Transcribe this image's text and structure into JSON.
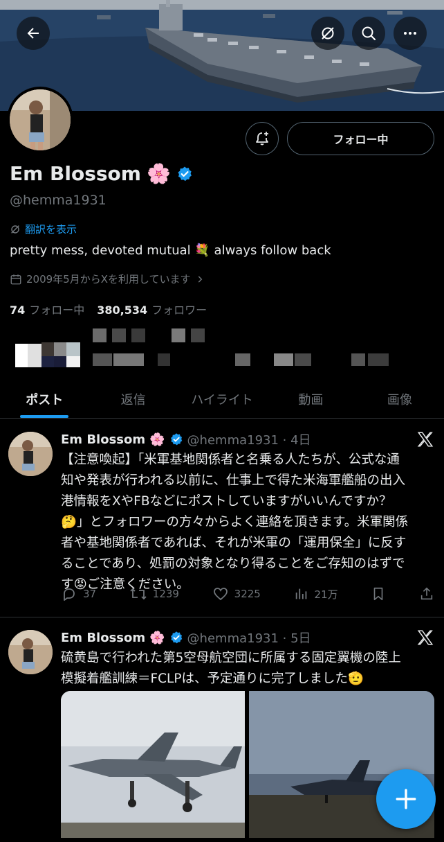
{
  "header": {
    "back_icon": "arrow-left-icon",
    "grok_icon": "grok-icon",
    "search_icon": "search-icon",
    "more_icon": "more-icon"
  },
  "profile": {
    "name": "Em Blossom",
    "name_emoji": "🌸",
    "handle": "@hemma1931",
    "follow_button_label": "フォロー中",
    "translate_link": "翻訳を表示",
    "bio": "pretty mess, devoted mutual 💐 always follow back",
    "joined": "2009年5月からXを利用しています",
    "following_count": "74",
    "following_label": "フォロー中",
    "followers_count": "380,534",
    "followers_label": "フォロワー"
  },
  "tabs": [
    {
      "label": "ポスト",
      "active": true
    },
    {
      "label": "返信",
      "active": false
    },
    {
      "label": "ハイライト",
      "active": false
    },
    {
      "label": "動画",
      "active": false
    },
    {
      "label": "画像",
      "active": false
    }
  ],
  "posts": [
    {
      "name": "Em Blossom",
      "name_emoji": "🌸",
      "handle_time": "@hemma1931 · 4日",
      "text": "【注意喚起】「米軍基地関係者と名乗る人たちが、公式な通\n知や発表が行われる以前に、仕事上で得た米海軍艦船の出入\n港情報をXやFBなどにポストしていますがいいんですか？\n🤔」とフォロワーの方々からよく連絡を頂きます。米軍関係\n者や基地関係者であれば、それが米軍の「運用保全」に反す\nることであり、処罰の対象となり得ることをご存知のはずで\nす😡ご注意ください。",
      "replies": "37",
      "reposts": "1239",
      "likes": "3225",
      "views": "21万"
    },
    {
      "name": "Em Blossom",
      "name_emoji": "🌸",
      "handle_time": "@hemma1931 · 5日",
      "text": "硫黄島で行われた第5空母航空団に所属する固定翼機の陸上\n模擬着艦訓練＝FCLPは、予定通りに完了しました🫡"
    }
  ],
  "colors": {
    "accent": "#1d9bf0",
    "background": "#000000",
    "text": "#e7e9ea",
    "muted": "#71767b",
    "border": "#2f3336"
  }
}
